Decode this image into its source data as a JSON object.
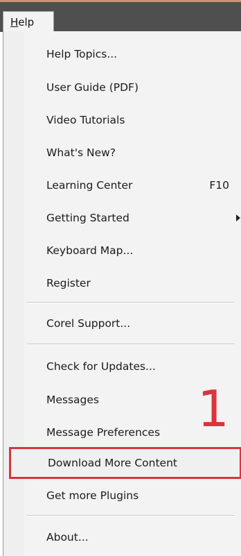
{
  "menubar": {
    "open_menu_label": "Help",
    "open_menu_mnemonic": "H"
  },
  "menu": {
    "items": [
      {
        "label": "Help Topics..."
      },
      {
        "label": "User Guide (PDF)"
      },
      {
        "label": "Video Tutorials"
      },
      {
        "label": "What's New?"
      },
      {
        "label": "Learning Center",
        "shortcut": "F10"
      },
      {
        "label": "Getting Started",
        "has_submenu": true
      },
      {
        "label": "Keyboard Map..."
      },
      {
        "label": "Register"
      },
      {
        "label": "Corel Support..."
      },
      {
        "label": "Check for Updates..."
      },
      {
        "label": "Messages"
      },
      {
        "label": "Message Preferences"
      },
      {
        "label": "Download More Content",
        "highlighted": true
      },
      {
        "label": "Get more Plugins"
      },
      {
        "label": "About..."
      }
    ]
  },
  "annotation": {
    "text": "1",
    "color": "#d9353f"
  },
  "colors": {
    "menubar_bg": "#4f4f4f",
    "menu_bg": "#f3f3f3",
    "highlight_border": "#d9353f"
  }
}
